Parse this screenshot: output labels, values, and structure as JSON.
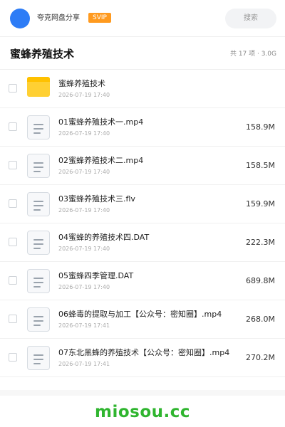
{
  "header": {
    "user_name": "夸克网盘分享",
    "badge": "SVIP",
    "search_placeholder": "搜索"
  },
  "folder": {
    "title": "蜜蜂养殖技术",
    "summary": "共 17 项 · 3.0G"
  },
  "files": [
    {
      "name": "蜜蜂养殖技术",
      "date": "2026-07-19 17:40",
      "size": "",
      "icon": "folder-icon"
    },
    {
      "name": "01蜜蜂养殖技术一.mp4",
      "date": "2026-07-19 17:40",
      "size": "158.9M",
      "icon": "file-icon"
    },
    {
      "name": "02蜜蜂养殖技术二.mp4",
      "date": "2026-07-19 17:40",
      "size": "158.5M",
      "icon": "file-icon"
    },
    {
      "name": "03蜜蜂养殖技术三.flv",
      "date": "2026-07-19 17:40",
      "size": "159.9M",
      "icon": "file-icon"
    },
    {
      "name": "04蜜蜂的养殖技术四.DAT",
      "date": "2026-07-19 17:40",
      "size": "222.3M",
      "icon": "file-icon"
    },
    {
      "name": "05蜜蜂四季管理.DAT",
      "date": "2026-07-19 17:40",
      "size": "689.8M",
      "icon": "file-icon"
    },
    {
      "name": "06蜂毒的提取与加工【公众号：密知圈】.mp4",
      "date": "2026-07-19 17:41",
      "size": "268.0M",
      "icon": "file-icon"
    },
    {
      "name": "07东北黑蜂的养殖技术【公众号：密知圈】.mp4",
      "date": "2026-07-19 17:41",
      "size": "270.2M",
      "icon": "file-icon"
    }
  ],
  "watermark": "miosou.cc",
  "colors": {
    "accent": "#2d7cf6",
    "svip": "#ff9a1f",
    "folder": "#ffd033",
    "watermark": "#2fb52f"
  }
}
